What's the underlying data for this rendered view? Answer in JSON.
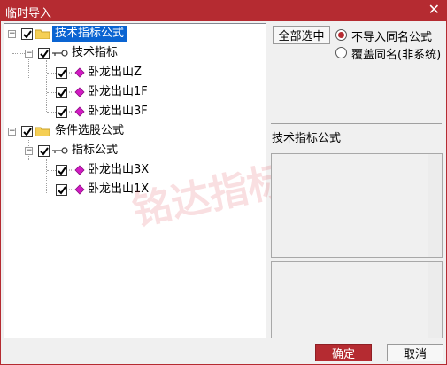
{
  "window": {
    "title": "临时导入",
    "close_glyph": "✕"
  },
  "tree": {
    "groups": [
      {
        "label": "技术指标公式",
        "selected": true,
        "children": [
          {
            "label": "技术指标",
            "items": [
              "卧龙出山Z",
              "卧龙出山1F",
              "卧龙出山3F"
            ]
          }
        ]
      },
      {
        "label": "条件选股公式",
        "selected": false,
        "children": [
          {
            "label": "指标公式",
            "items": [
              "卧龙出山3X",
              "卧龙出山1X"
            ]
          }
        ]
      }
    ]
  },
  "options": {
    "select_all_label": "全部选中",
    "radio_no_import_label": "不导入同名公式",
    "radio_overwrite_label": "覆盖同名(非系统)",
    "selected_radio": "no_import"
  },
  "info": {
    "section_title": "技术指标公式"
  },
  "footer": {
    "ok_label": "确定",
    "cancel_label": "取消"
  },
  "colors": {
    "accent": "#b52b31",
    "selection": "#0a64d2"
  },
  "watermark": "铭达指标"
}
